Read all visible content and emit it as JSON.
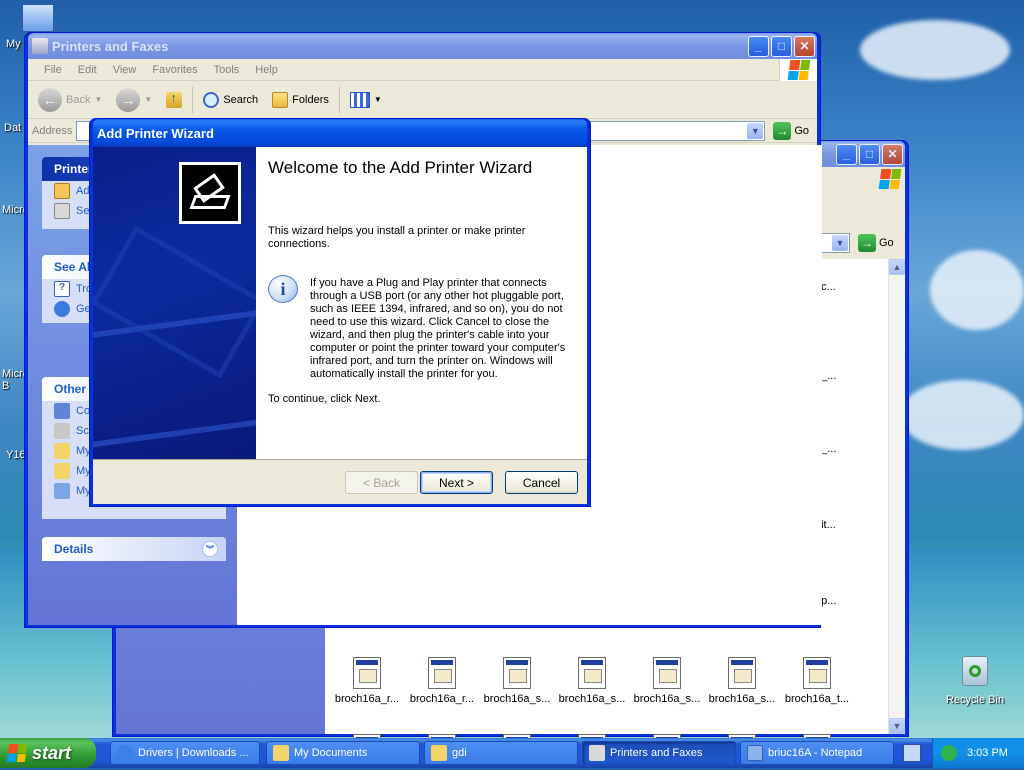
{
  "desktop": {
    "icons": [
      {
        "label": "My"
      },
      {
        "label": "Dat"
      },
      {
        "label": "Micro"
      },
      {
        "label": "Micro B"
      },
      {
        "label": "Y16"
      },
      {
        "label": "Recycle Bin"
      }
    ]
  },
  "back_window": {
    "address_go": "Go",
    "files_row1": [
      "broch16a_r...",
      "broch16a_r...",
      "broch16a_s...",
      "broch16a_s...",
      "broch16a_s...",
      "broch16a_s...",
      "broch16a_t..."
    ],
    "partial_names": [
      "0c...",
      "a_...",
      "a_...",
      "_it...",
      "_p..."
    ]
  },
  "main_window": {
    "title": "Printers and Faxes",
    "menu": [
      "File",
      "Edit",
      "View",
      "Favorites",
      "Tools",
      "Help"
    ],
    "toolbar": {
      "back": "Back",
      "search": "Search",
      "folders": "Folders"
    },
    "address_label": "Address",
    "go": "Go",
    "left_pane": {
      "printer_tasks": {
        "title": "Printer",
        "items": [
          "Ad",
          "Se"
        ]
      },
      "see_also": {
        "title": "See Als",
        "items": [
          "Tro",
          "Ge"
        ]
      },
      "other_places": {
        "title": "Other P",
        "items": [
          "Co",
          "Sca",
          "My",
          "My",
          "My"
        ]
      },
      "details": {
        "title": "Details"
      }
    }
  },
  "wizard": {
    "title": "Add Printer Wizard",
    "heading": "Welcome to the Add Printer Wizard",
    "intro": "This wizard helps you install a printer or make printer connections.",
    "info": "If you have a Plug and Play printer that connects through a USB port (or any other hot pluggable port, such as IEEE 1394, infrared, and so on), you do not need to use this wizard. Click Cancel to close the wizard, and then plug the printer's cable into your computer or point the printer toward your computer's infrared port, and turn the printer on. Windows will automatically install the printer for you.",
    "continue": "To continue, click Next.",
    "buttons": {
      "back": "< Back",
      "next": "Next >",
      "cancel": "Cancel"
    }
  },
  "taskbar": {
    "start": "start",
    "items": [
      {
        "label": "Drivers | Downloads ..."
      },
      {
        "label": "My Documents"
      },
      {
        "label": "gdi"
      },
      {
        "label": "Printers and Faxes"
      },
      {
        "label": "briuc16A - Notepad"
      }
    ],
    "clock": "3:03 PM"
  },
  "colors": {
    "xp_blue": "#0831d9",
    "task_pane": "#6375d6",
    "start_green": "#3c9a3c"
  }
}
